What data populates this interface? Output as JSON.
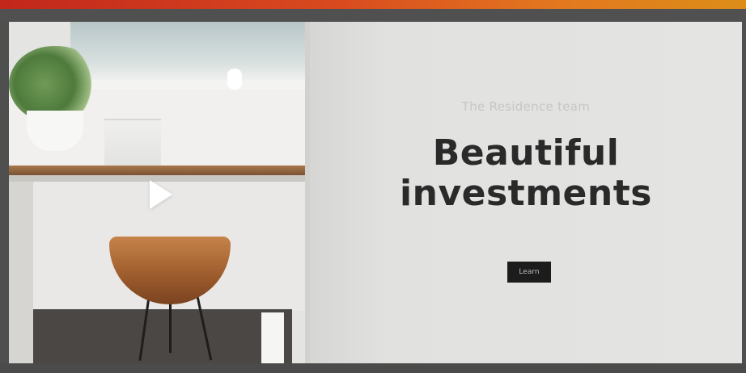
{
  "hero": {
    "eyebrow": "The Residence team",
    "headline_line1": "Beautiful",
    "headline_line2": "investments",
    "cta_label": "Learn"
  },
  "media": {
    "play_icon": "play-icon",
    "photo_subject": "chair-and-shelf-photo"
  },
  "colors": {
    "top_strip_start": "#c2261c",
    "top_strip_end": "#dc8d18",
    "frame": "#4f4f4f",
    "hero_bg": "#e1e1df",
    "headline": "#2a2a2a",
    "button_bg": "#1c1c1c"
  }
}
